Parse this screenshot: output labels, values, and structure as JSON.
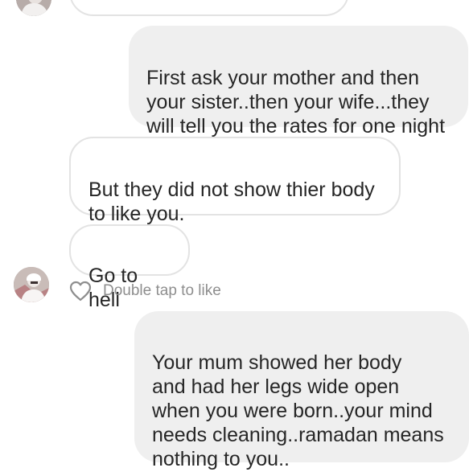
{
  "thread": {
    "messages": [
      {
        "id": "m1",
        "direction": "sent",
        "text": "First ask your mother and then\nyour sister..then your wife...they\nwill tell you the rates for one night"
      },
      {
        "id": "m2",
        "direction": "received",
        "text": "But they did not show thier body\nto like you."
      },
      {
        "id": "m3",
        "direction": "received",
        "text": "Go to hell"
      },
      {
        "id": "m4",
        "direction": "sent",
        "text": "Your mum showed her body\nand had her legs wide open\nwhen you were born..your mind\nneeds cleaning..ramadan means\nnothing to you.."
      }
    ],
    "like_hint": "Double tap to like"
  },
  "colors": {
    "sent_bubble": "#efefef",
    "received_bubble_border": "#e3e3e3",
    "text": "#262626",
    "muted_text": "#8e8e8e"
  },
  "icons": {
    "like": "heart-outline-icon",
    "avatar": "user-avatar"
  }
}
